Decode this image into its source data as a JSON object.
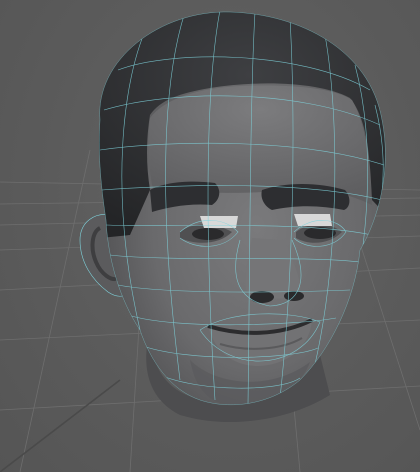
{
  "viewport": {
    "background_color": "#5c5c5c",
    "grid_visible": true,
    "grid_color": "#6e6e6e",
    "wireframe_on_shaded": true,
    "wireframe_color": "#7fd3dc"
  },
  "model": {
    "subject": "3D head mesh",
    "shading": "smooth-shaded-gray",
    "surface_color": "#6f6f71",
    "hair_color": "#333437",
    "eyebrow_color": "#2b2c2f"
  }
}
